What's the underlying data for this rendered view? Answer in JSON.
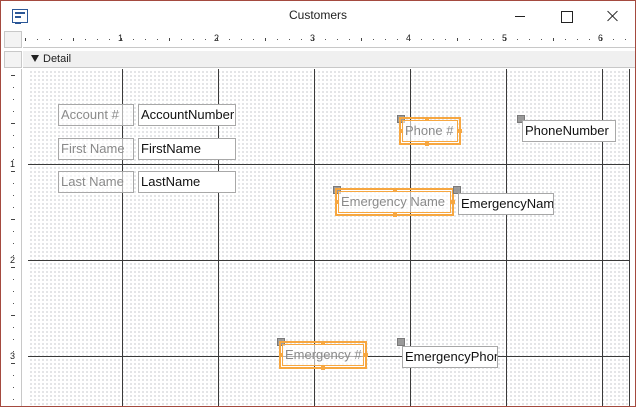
{
  "window": {
    "title": "Customers",
    "icon": "access-form-icon"
  },
  "ruler": {
    "horizontal_numbers": [
      "1",
      "2",
      "3",
      "4",
      "5",
      "6"
    ],
    "vertical_numbers": [
      "1",
      "2",
      "3"
    ]
  },
  "section": {
    "name": "Detail"
  },
  "controls": {
    "account_label": "Account #",
    "account_field": "AccountNumber",
    "first_name_label": "First Name",
    "first_name_field": "FirstName",
    "last_name_label": "Last Name",
    "last_name_field": "LastName",
    "phone_label": "Phone #",
    "phone_field": "PhoneNumber",
    "emergency_name_label": "Emergency Name",
    "emergency_name_field": "EmergencyName",
    "emergency_phone_label": "Emergency #",
    "emergency_phone_field": "EmergencyPhone"
  },
  "colors": {
    "selection": "#f7a740",
    "grid_line": "#3a3a3a",
    "window_border": "#a44a3f"
  }
}
